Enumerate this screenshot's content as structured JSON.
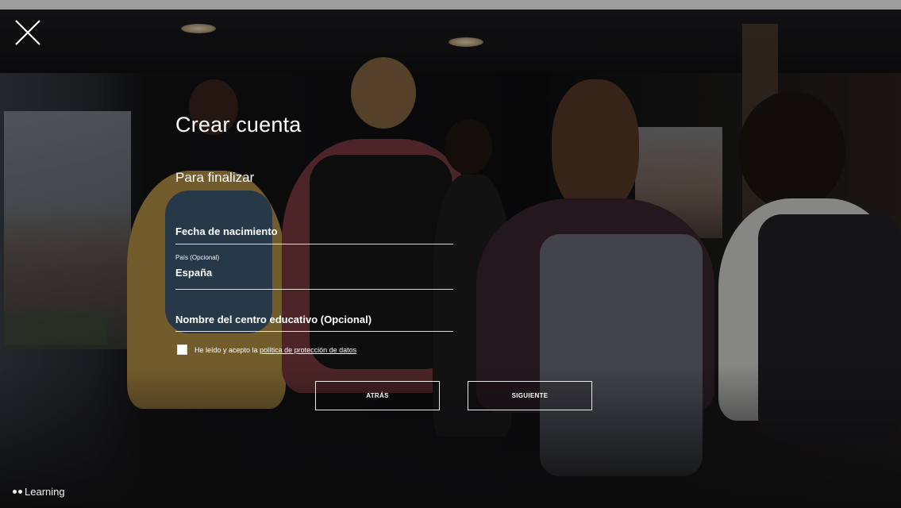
{
  "form": {
    "title": "Crear cuenta",
    "subtitle": "Para finalizar",
    "birth_date": {
      "placeholder": "Fecha de nacimiento"
    },
    "country": {
      "label": "País (Opcional)",
      "value": "España"
    },
    "school": {
      "placeholder": "Nombre del centro educativo (Opcional)"
    },
    "consent": {
      "text": "He leído y acepto la",
      "link": "política de protección de datos",
      "checked": false
    }
  },
  "buttons": {
    "back": "ATRÁS",
    "next": "SIGUIENTE"
  },
  "brand": {
    "name": "Learning"
  },
  "icons": {
    "close": "close-icon",
    "brand": "brand-dots-icon"
  },
  "colors": {
    "text": "#ffffff",
    "overlay": "rgba(0,0,0,0.38)",
    "line": "#ffffff"
  }
}
